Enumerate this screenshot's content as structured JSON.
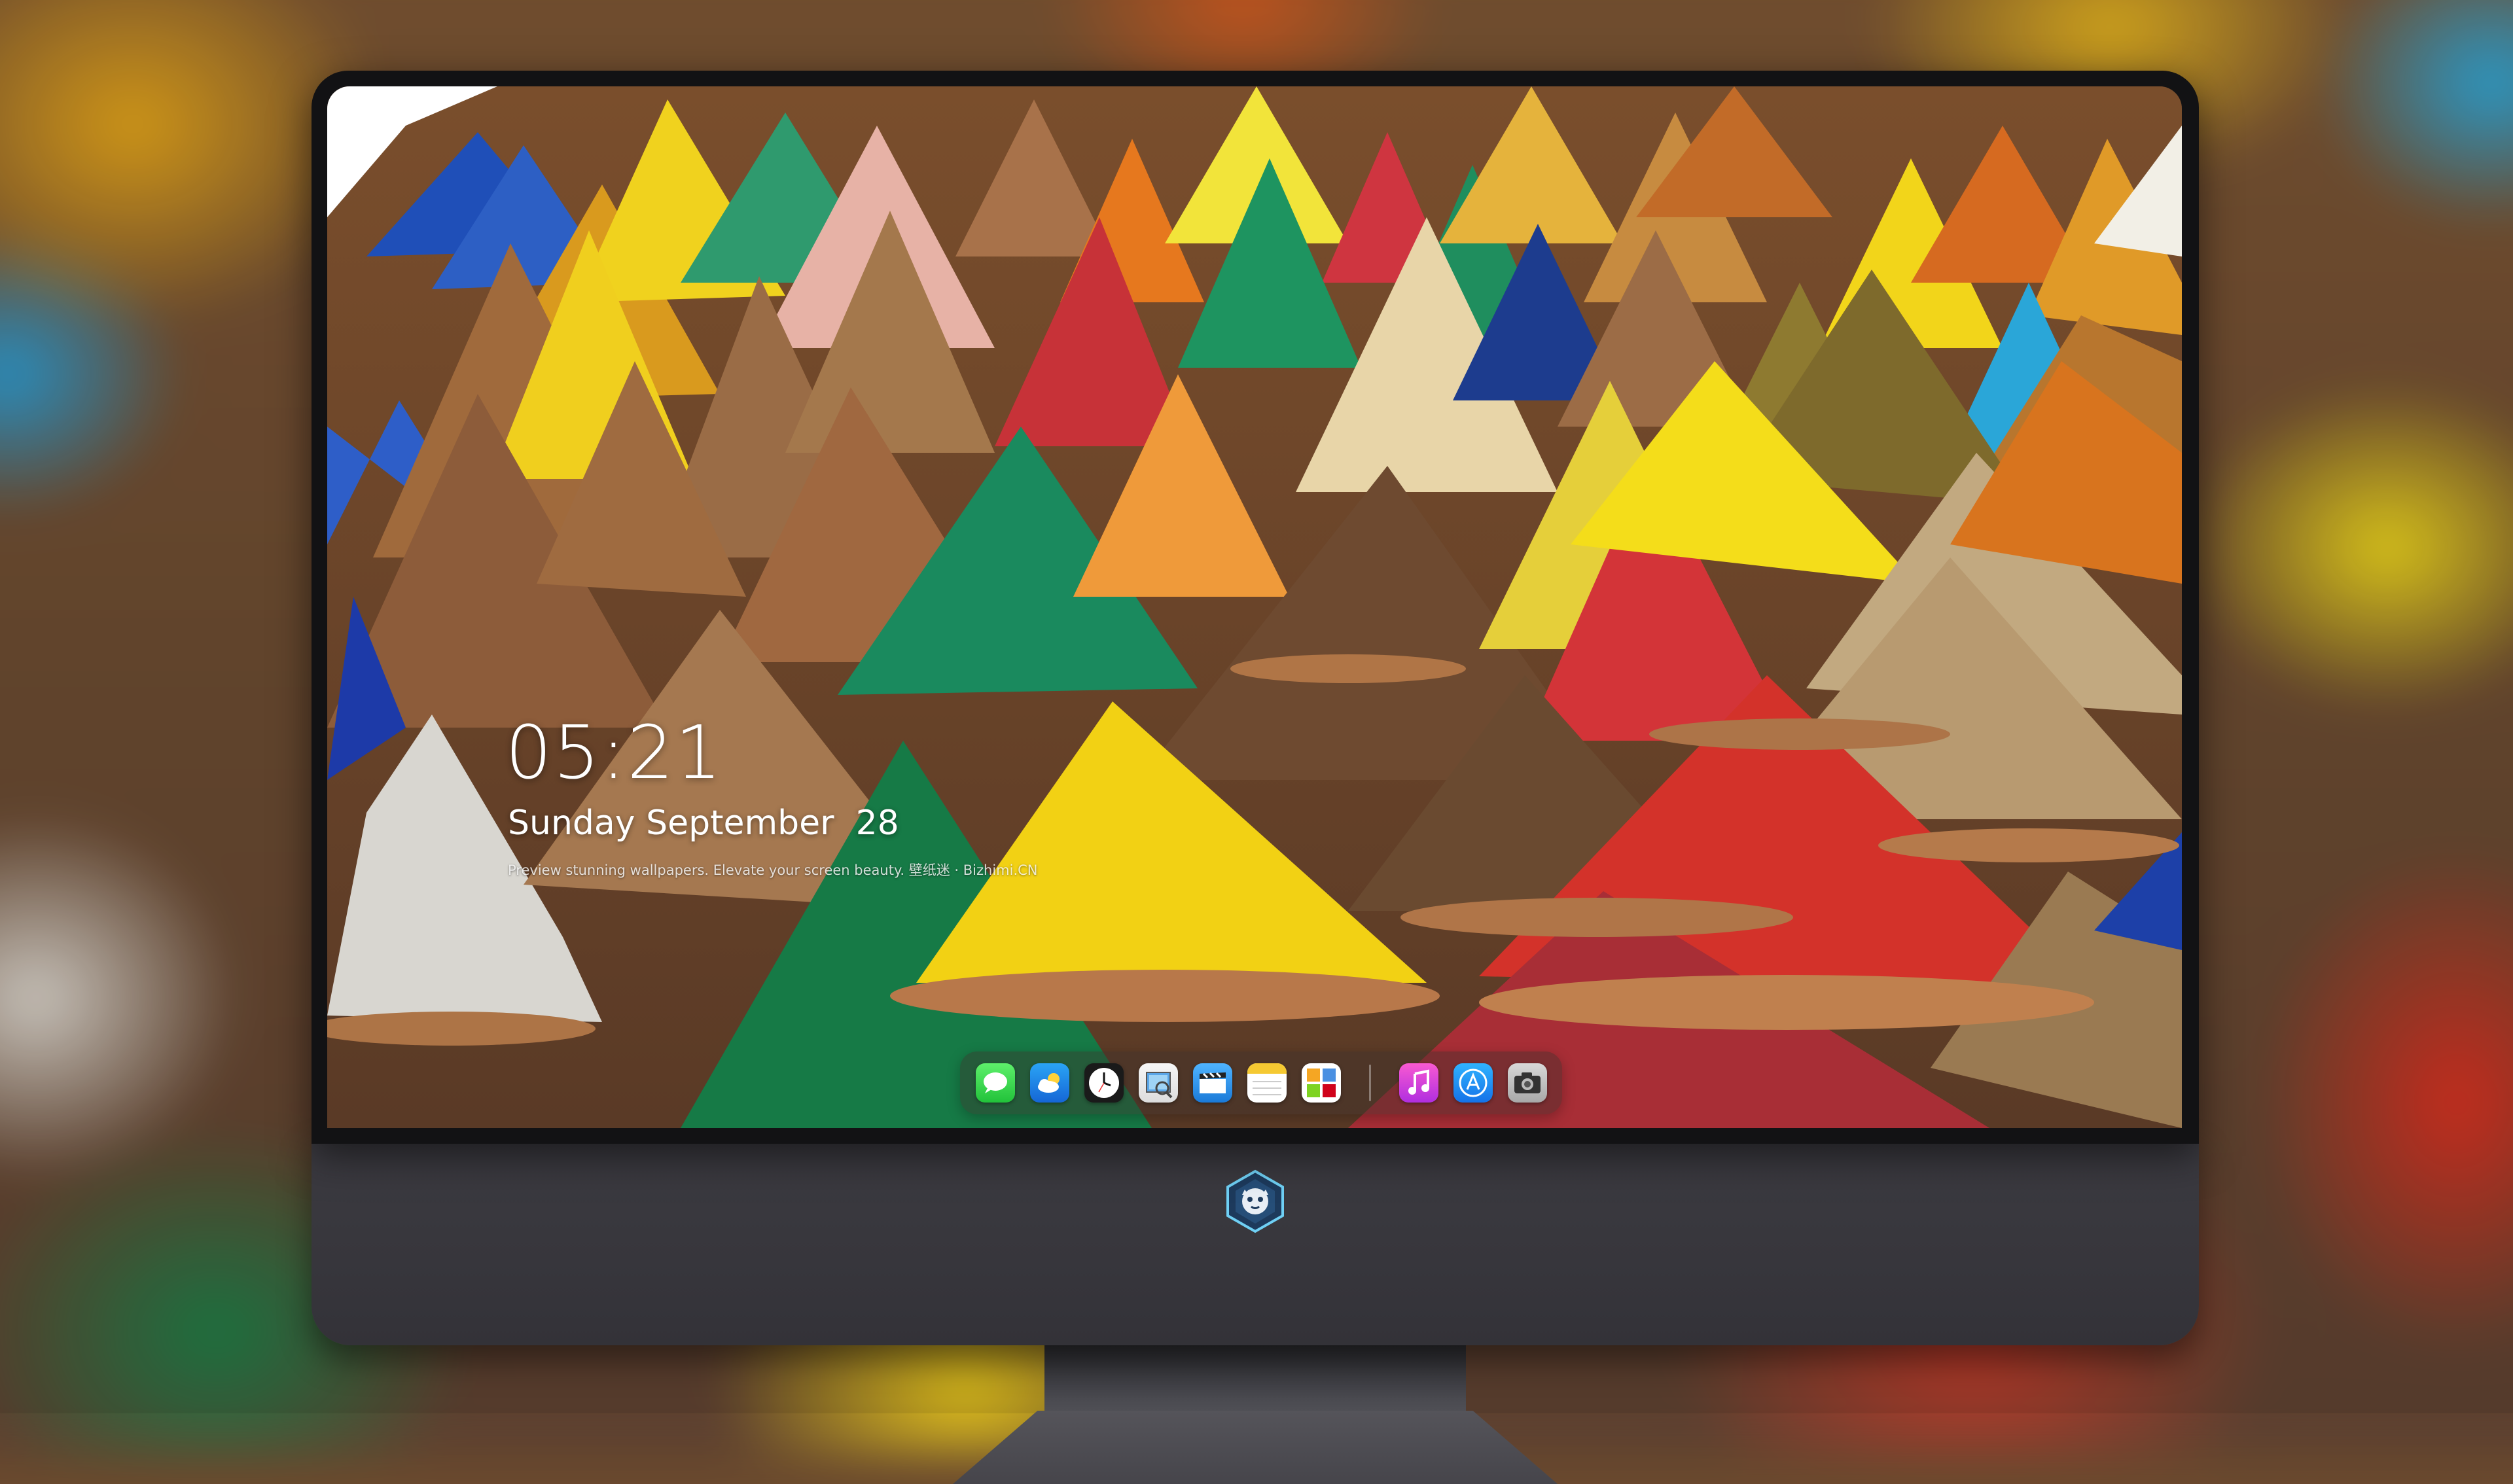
{
  "lock_screen": {
    "time": "05:21",
    "date": "Sunday September  28",
    "tagline": "Preview stunning wallpapers. Elevate your screen beauty. 壁纸迷 · Bizhimi.CN"
  },
  "dock": {
    "apps": [
      {
        "name": "messages-icon"
      },
      {
        "name": "weather-icon"
      },
      {
        "name": "clock-icon"
      },
      {
        "name": "preview-icon"
      },
      {
        "name": "clips-icon"
      },
      {
        "name": "notes-icon"
      },
      {
        "name": "photo-booth-icon"
      }
    ],
    "apps_right": [
      {
        "name": "itunes-icon"
      },
      {
        "name": "app-store-icon"
      },
      {
        "name": "camera-icon"
      }
    ]
  },
  "colors": {
    "bezel": "#121214",
    "chin": "#3a393f",
    "accent_blue": "#1a8ff5",
    "accent_green": "#2fcb4b"
  }
}
